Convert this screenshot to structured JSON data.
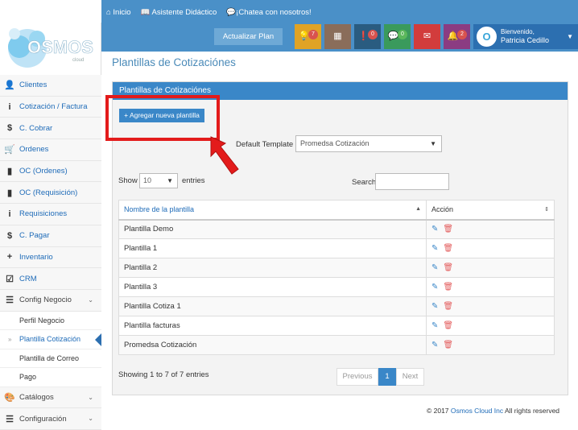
{
  "topbar": {
    "links": [
      {
        "icon": "home-icon",
        "label": "Inicio"
      },
      {
        "icon": "book-icon",
        "label": "Asistente Didáctico"
      },
      {
        "icon": "chat-icon",
        "label": "¡Chatea con nosotros!"
      }
    ],
    "upgrade_label": "Actualizar Plan",
    "notifications": [
      {
        "icon": "lightbulb-icon",
        "count": "7",
        "color": "#e0a325"
      },
      {
        "icon": "calendar-icon",
        "count": "",
        "color": "#8a6d5a"
      },
      {
        "icon": "alert-icon",
        "count": "0",
        "color": "#2a5c80"
      },
      {
        "icon": "comment-icon",
        "count": "0",
        "color": "#3a9a5c"
      },
      {
        "icon": "mail-icon",
        "count": "",
        "color": "#d23c3c"
      },
      {
        "icon": "bell-icon",
        "count": "2",
        "color": "#8b3c82"
      }
    ],
    "user": {
      "welcome": "Bienvenido,",
      "name": "Patricia Cedillo"
    }
  },
  "logo": {
    "text": "OSMOS",
    "sub": "cloud"
  },
  "sidebar": {
    "items": [
      {
        "icon": "user-icon",
        "glyph": "👤",
        "label": "Clientes"
      },
      {
        "icon": "info-icon",
        "glyph": "i",
        "label": "Cotización / Factura"
      },
      {
        "icon": "dollar-icon",
        "glyph": "$",
        "label": "C. Cobrar"
      },
      {
        "icon": "cart-icon",
        "glyph": "🛒",
        "label": "Ordenes"
      },
      {
        "icon": "file-icon",
        "glyph": "▮",
        "label": "OC (Ordenes)"
      },
      {
        "icon": "file-icon",
        "glyph": "▮",
        "label": "OC (Requisición)"
      },
      {
        "icon": "info-icon",
        "glyph": "i",
        "label": "Requisiciones"
      },
      {
        "icon": "dollar-icon",
        "glyph": "$",
        "label": "C. Pagar"
      },
      {
        "icon": "plus-icon",
        "glyph": "+",
        "label": "Inventario"
      },
      {
        "icon": "checkbox-icon",
        "glyph": "☑",
        "label": "CRM"
      },
      {
        "icon": "list-icon",
        "glyph": "☰",
        "label": "Config Negocio"
      }
    ],
    "subitems": [
      {
        "label": "Perfil Negocio"
      },
      {
        "label": "Plantilla Cotización"
      },
      {
        "label": "Plantilla de Correo"
      },
      {
        "label": "Pago"
      }
    ],
    "bottom": [
      {
        "icon": "palette-icon",
        "glyph": "🎨",
        "label": "Catálogos"
      },
      {
        "icon": "list-icon",
        "glyph": "☰",
        "label": "Configuración"
      }
    ]
  },
  "page": {
    "title": "Plantillas de Cotizaciónes",
    "panel_title": "Plantillas de Cotizaciónes",
    "add_button": "+ Agregar nueva plantilla",
    "default_template_label": "Default Template",
    "default_template_value": "Promedsa Cotización",
    "show_label": "Show",
    "show_value": "10",
    "entries_label": "entries",
    "search_label": "Search:",
    "search_value": ""
  },
  "table": {
    "columns": [
      "Nombre de la plantilla",
      "Acción"
    ],
    "rows": [
      "Plantilla Demo",
      "Plantilla 1",
      "Plantilla 2",
      "Plantilla 3",
      "Plantilla Cotiza 1",
      "Plantilla facturas",
      "Promedsa Cotización"
    ]
  },
  "footer_table": {
    "info": "Showing 1 to 7 of 7 entries",
    "prev": "Previous",
    "current": "1",
    "next": "Next"
  },
  "footer": {
    "prefix": "© 2017 ",
    "link": "Osmos Cloud Inc",
    "suffix": " All rights reserved"
  }
}
